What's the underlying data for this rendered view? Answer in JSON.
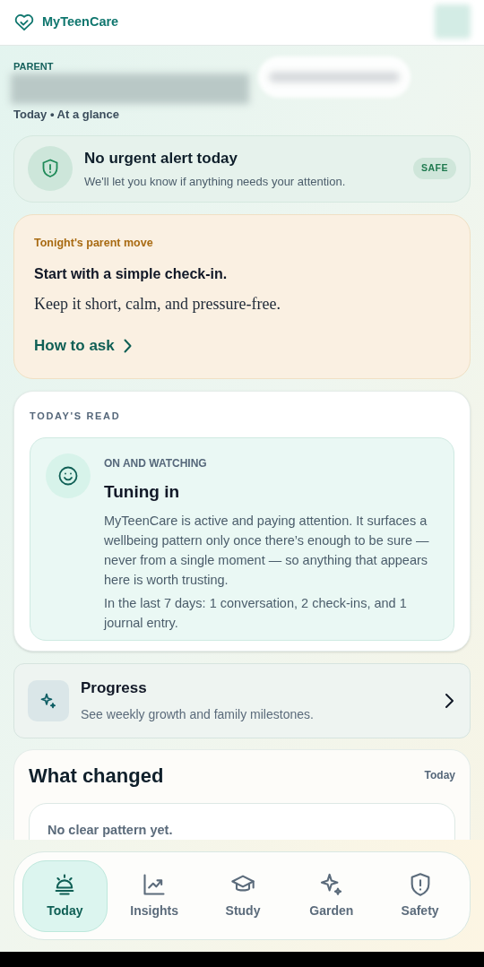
{
  "header": {
    "app_name": "MyTeenCare"
  },
  "greeting": {
    "eyebrow": "PARENT",
    "subtitle": "Today • At a glance"
  },
  "alert": {
    "title": "No urgent alert today",
    "message": "We'll let you know if anything needs your attention.",
    "badge": "SAFE"
  },
  "parent_move": {
    "eyebrow": "Tonight's parent move",
    "title": "Start with a simple check-in.",
    "body": "Keep it short, calm, and pressure-free.",
    "link": "How to ask"
  },
  "todays_read": {
    "heading": "TODAY'S READ",
    "eyebrow": "ON AND WATCHING",
    "title": "Tuning in",
    "paragraphs": [
      "MyTeenCare is active and paying attention. It surfaces a wellbeing pattern only once there’s enough to be sure — never from a single moment — so anything that appears here is worth trusting.",
      "In the last 7 days: 1 conversation, 2 check-ins, and 1 journal entry."
    ]
  },
  "progress": {
    "title": "Progress",
    "subtitle": "See weekly growth and family milestones."
  },
  "what_changed": {
    "title": "What changed",
    "date": "Today",
    "empty": "No clear pattern yet."
  },
  "nav": [
    {
      "label": "Today",
      "selected": true
    },
    {
      "label": "Insights",
      "selected": false
    },
    {
      "label": "Study",
      "selected": false
    },
    {
      "label": "Garden",
      "selected": false
    },
    {
      "label": "Safety",
      "selected": false
    }
  ]
}
